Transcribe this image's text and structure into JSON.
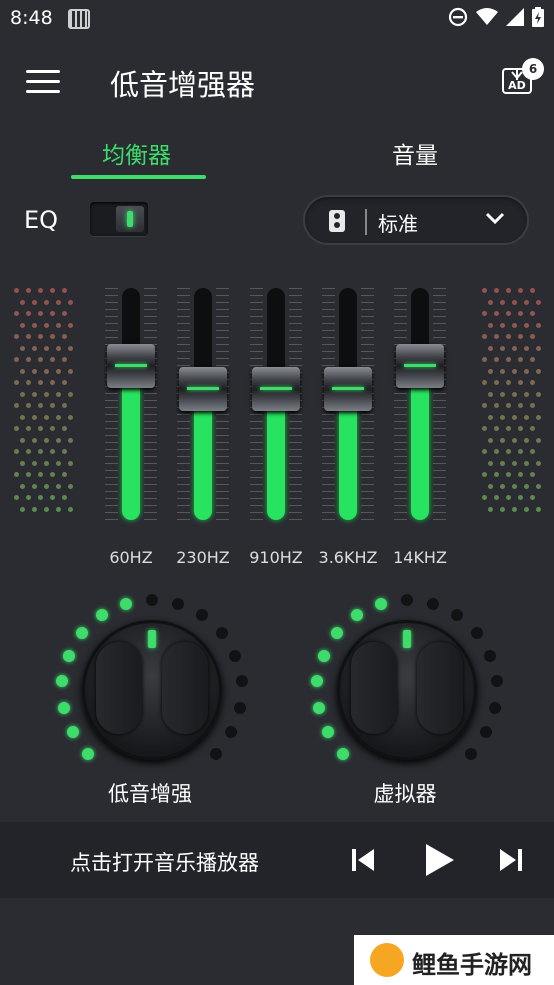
{
  "status_bar": {
    "time": "8:48"
  },
  "app_bar": {
    "title": "低音增强器",
    "ad_badge": "6",
    "ad_text": "AD"
  },
  "tabs": [
    {
      "label": "均衡器",
      "active": true
    },
    {
      "label": "音量",
      "active": false
    }
  ],
  "eq": {
    "label": "EQ",
    "enabled": true,
    "preset": "标准"
  },
  "bands": [
    {
      "label": "60HZ",
      "level": 0.63
    },
    {
      "label": "230HZ",
      "level": 0.53
    },
    {
      "label": "910HZ",
      "level": 0.53
    },
    {
      "label": "3.6KHZ",
      "level": 0.53
    },
    {
      "label": "14KHZ",
      "level": 0.63
    }
  ],
  "knobs": [
    {
      "label": "低音增强",
      "level": 0.47
    },
    {
      "label": "虚拟器",
      "level": 0.47
    }
  ],
  "player": {
    "text": "点击打开音乐播放器"
  },
  "watermark": {
    "text": "鲤鱼手游网"
  },
  "colors": {
    "accent": "#3ddc6b",
    "background": "#2a2c31"
  }
}
